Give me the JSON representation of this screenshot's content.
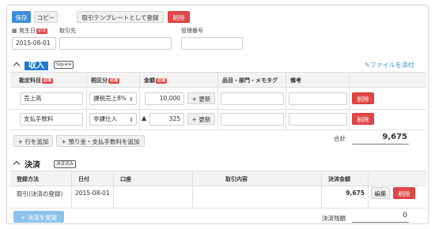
{
  "toolbar": {
    "save": "保存",
    "copy": "コピー",
    "register_template": "取引テンプレートとして登録",
    "delete": "削除"
  },
  "header_fields": {
    "date_label": "発生日",
    "required": "必須",
    "date_value": "2015-08-01",
    "partner_label": "取引先",
    "partner_value": "",
    "management_no_label": "管理番号",
    "management_no_value": ""
  },
  "income": {
    "title": "収入",
    "tag": "Square",
    "attach_link": "ファイルを添付",
    "columns": [
      "勘定科目",
      "税区分",
      "金額",
      "品目・部門・メモタグ",
      "備考"
    ],
    "rows": [
      {
        "account": "売上高",
        "tax": "課税売上8%",
        "amount": "10,000",
        "update": "更新",
        "delete": "削除"
      },
      {
        "account": "支払手数料",
        "tax": "非課仕入",
        "amount": "325",
        "sign": "▲",
        "update": "更新",
        "delete": "削除"
      }
    ],
    "add_row": "行を追加",
    "add_deposit": "預り金・支払手数料を追加",
    "total_label": "合計",
    "total_value": "9,675"
  },
  "settlement": {
    "title": "決済",
    "tag": "決済済み",
    "columns": [
      "登録方法",
      "日付",
      "口座",
      "取引内容",
      "決済金額"
    ],
    "rows": [
      {
        "method": "取引(決済の登録)",
        "date": "2015-08-01",
        "account": "",
        "content": "",
        "amount": "9,675",
        "edit": "編集",
        "delete": "削除"
      }
    ],
    "register_button": "決済を登録",
    "remaining_label": "決済残額",
    "remaining_value": "0"
  },
  "colors": {
    "primary": "#3d8fd9",
    "danger": "#e04848",
    "highlight": "#1e7bcc"
  }
}
